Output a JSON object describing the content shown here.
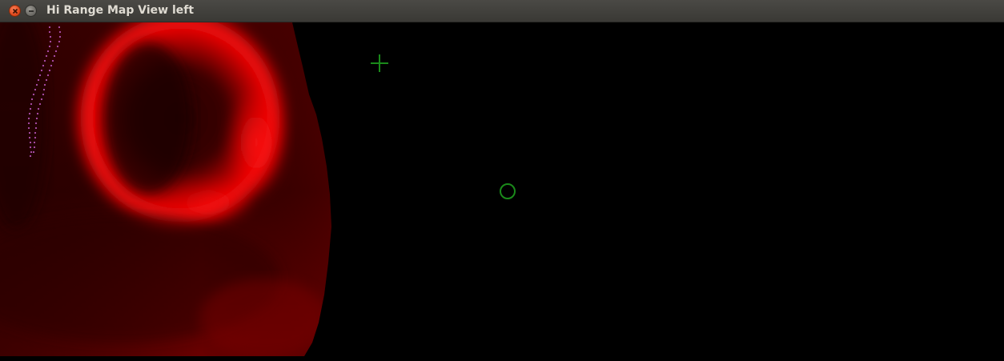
{
  "window": {
    "title": "Hi Range Map View left",
    "controls": {
      "close_icon": "close-icon",
      "minimize_icon": "minimize-icon"
    }
  },
  "map_view": {
    "background_color": "#000000",
    "range_map_color": "#ff0000",
    "marker_color": "#1a8a1a",
    "trail_color": "#b050b0",
    "markers": [
      {
        "type": "crosshair",
        "icon": "crosshair-icon"
      },
      {
        "type": "circle",
        "icon": "target-circle-icon"
      }
    ]
  }
}
